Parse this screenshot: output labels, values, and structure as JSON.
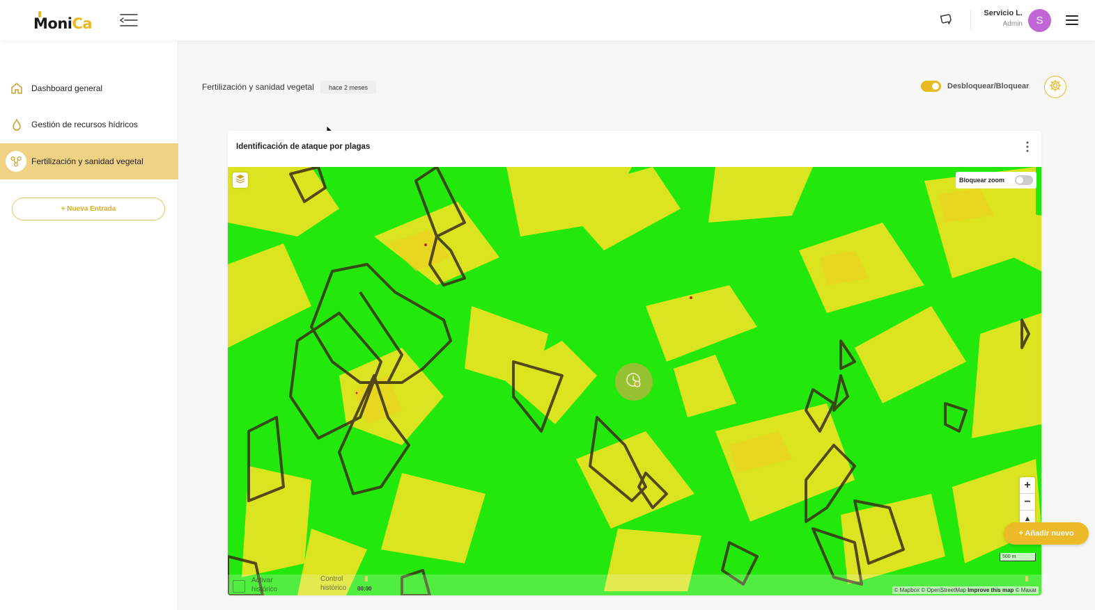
{
  "header": {
    "logo_main": "Moni",
    "logo_accent": "Ca",
    "user_name": "Servicio L.",
    "user_role": "Admin",
    "avatar_initial": "S"
  },
  "sidebar": {
    "items": [
      {
        "label": "Dashboard general",
        "icon": "home-icon",
        "active": false
      },
      {
        "label": "Gestión de recursos hídricos",
        "icon": "water-drop-icon",
        "active": false
      },
      {
        "label": "Fertilización y sanidad vegetal",
        "icon": "plant-nodes-icon",
        "active": true
      }
    ],
    "new_entry_label": "+ Nueva Entrada"
  },
  "page": {
    "breadcrumb": "Fertilización y sanidad vegetal",
    "updated_badge": "hace 2 meses",
    "lock_toggle_label": "Desbloquear/Bloquear",
    "lock_toggle_on": true
  },
  "card": {
    "title": "Identificación de ataque por plagas",
    "map": {
      "zoom_lock_label": "Bloquear zoom",
      "zoom_lock_on": false,
      "zoom_in": "+",
      "zoom_out": "−",
      "compass": "▲",
      "scale_label": "500 m",
      "timeline": {
        "activate_label": "Activar histórico",
        "control_label": "Control histórico",
        "time": "00:00"
      },
      "attribution": {
        "mapbox": "© Mapbox",
        "osm": "© OpenStreetMap",
        "improve": "Improve this map",
        "maxar": "© Maxar"
      }
    }
  },
  "add_new_label": "+ Añadir nuevo",
  "colors": {
    "accent": "#e8b923",
    "active_nav": "#efd283",
    "map_green": "#1ee80a",
    "map_yellow": "#e9e41e",
    "avatar": "#c266d6"
  }
}
